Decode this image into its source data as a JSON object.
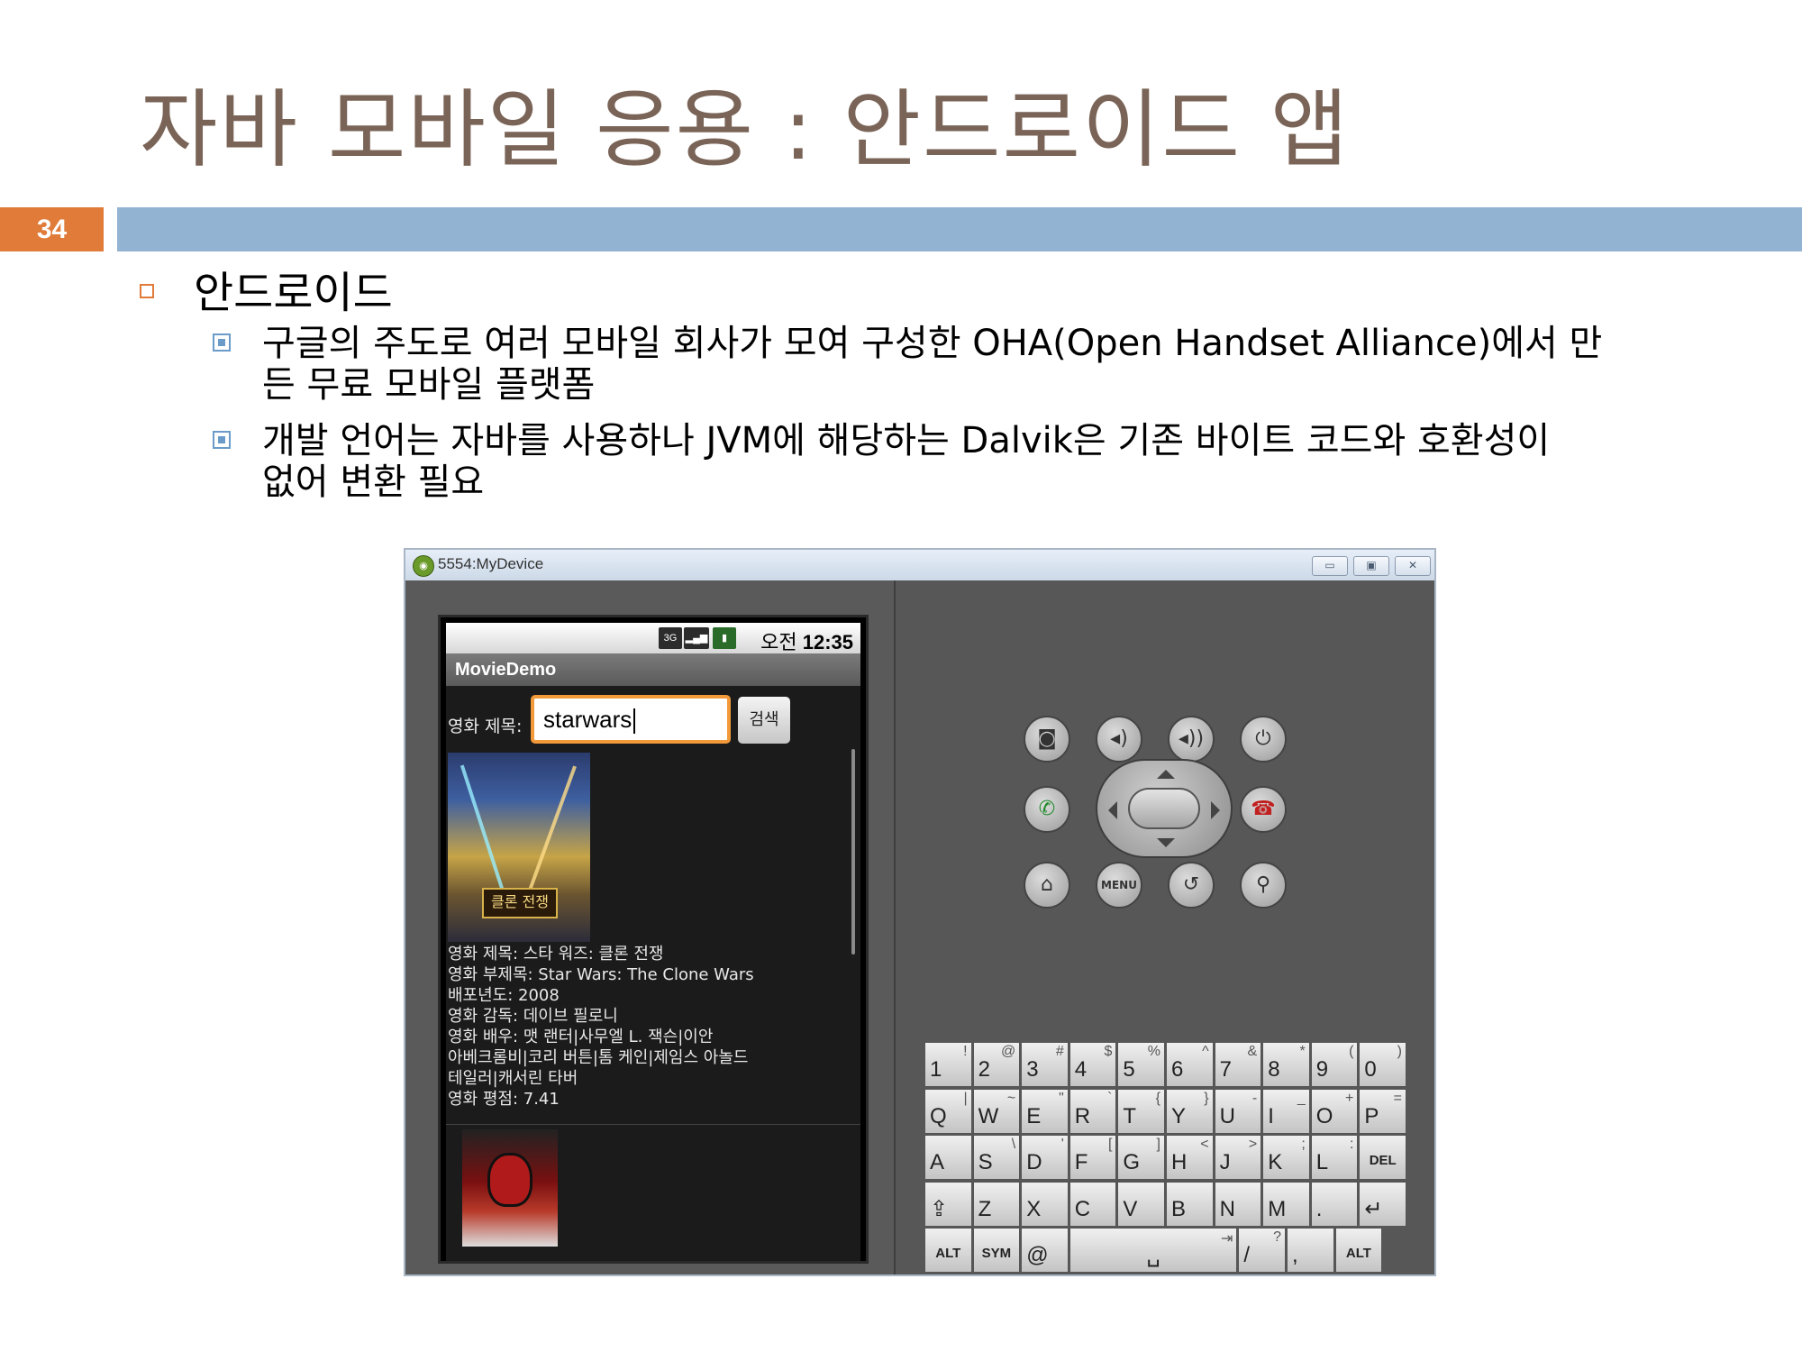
{
  "slide": {
    "title": "자바 모바일 응용 : 안드로이드 앱",
    "number": "34",
    "bullet_l1": "안드로이드",
    "bullets_l2": [
      {
        "line1": "구글의 주도로 여러 모바일 회사가 모여 구성한 OHA(Open Handset Alliance)에서 만",
        "line2": "든 무료 모바일 플랫폼"
      },
      {
        "line1": "개발 언어는 자바를 사용하나 JVM에 해당하는 Dalvik은 기존 바이트 코드와 호환성이",
        "line2": "없어 변환 필요"
      }
    ]
  },
  "emulator": {
    "window_title": "5554:MyDevice",
    "status": {
      "network": "3G",
      "ampm": "오전",
      "time": "12:35"
    },
    "app_title": "MovieDemo",
    "search": {
      "label": "영화 제목:",
      "value": "starwars",
      "button": "검색"
    },
    "poster_text": "클론 전쟁",
    "movie_info": [
      "영화 제목: 스타 워즈: 클론 전쟁",
      "영화 부제목: Star Wars: The Clone Wars",
      "배포년도: 2008",
      "영화 감독: 데이브 필로니",
      "영화 배우: 맷 랜터|사무엘 L. 잭슨|이안",
      "아베크롬비|코리 버튼|톰 케인|제임스 아놀드",
      "테일러|캐서린 타버",
      "영화 평점: 7.41"
    ],
    "hw_menu_label": "MENU",
    "keyboard": {
      "row1": [
        [
          "1",
          "!"
        ],
        [
          "2",
          "@"
        ],
        [
          "3",
          "#"
        ],
        [
          "4",
          "$"
        ],
        [
          "5",
          "%"
        ],
        [
          "6",
          "^"
        ],
        [
          "7",
          "&"
        ],
        [
          "8",
          "*"
        ],
        [
          "9",
          "("
        ],
        [
          "0",
          ")"
        ]
      ],
      "row2": [
        [
          "Q",
          "|"
        ],
        [
          "W",
          "~"
        ],
        [
          "E",
          "\""
        ],
        [
          "R",
          "`"
        ],
        [
          "T",
          "{"
        ],
        [
          "Y",
          "}"
        ],
        [
          "U",
          "-"
        ],
        [
          "I",
          "_"
        ],
        [
          "O",
          "+"
        ],
        [
          "P",
          "="
        ]
      ],
      "row3": [
        [
          "A",
          ""
        ],
        [
          "S",
          "\\"
        ],
        [
          "D",
          "'"
        ],
        [
          "F",
          "["
        ],
        [
          "G",
          "]"
        ],
        [
          "H",
          "<"
        ],
        [
          "J",
          ">"
        ],
        [
          "K",
          ";"
        ],
        [
          "L",
          ":"
        ],
        [
          "DEL",
          ""
        ]
      ],
      "row4": [
        [
          "⇪",
          ""
        ],
        [
          "Z",
          ""
        ],
        [
          "X",
          ""
        ],
        [
          "C",
          ""
        ],
        [
          "V",
          ""
        ],
        [
          "B",
          ""
        ],
        [
          "N",
          ""
        ],
        [
          "M",
          ""
        ],
        [
          ".",
          ""
        ],
        [
          "↵",
          ""
        ]
      ],
      "row5": [
        [
          "ALT",
          ""
        ],
        [
          "SYM",
          ""
        ],
        [
          "@",
          ""
        ],
        [
          "␣",
          "⇥"
        ],
        [
          "/",
          "?"
        ],
        [
          ",",
          ""
        ],
        [
          "ALT",
          ""
        ]
      ]
    }
  }
}
